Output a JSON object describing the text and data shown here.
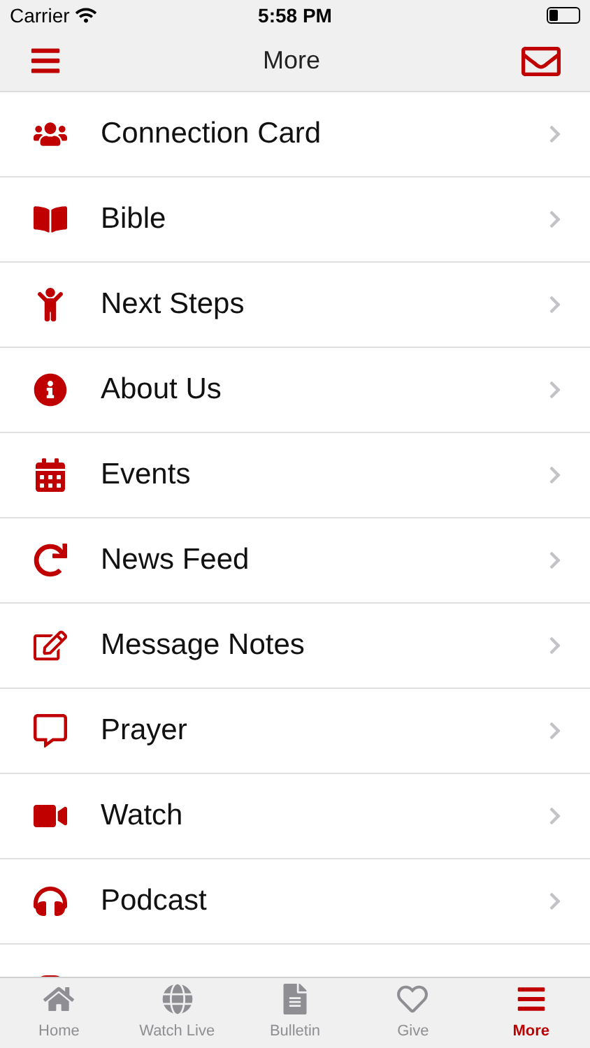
{
  "status_bar": {
    "carrier": "Carrier",
    "time": "5:58 PM"
  },
  "nav_bar": {
    "title": "More"
  },
  "menu": [
    {
      "label": "Connection Card"
    },
    {
      "label": "Bible"
    },
    {
      "label": "Next Steps"
    },
    {
      "label": "About Us"
    },
    {
      "label": "Events"
    },
    {
      "label": "News Feed"
    },
    {
      "label": "Message Notes"
    },
    {
      "label": "Prayer"
    },
    {
      "label": "Watch"
    },
    {
      "label": "Podcast"
    }
  ],
  "tabs": [
    {
      "label": "Home",
      "selected": false
    },
    {
      "label": "Watch Live",
      "selected": false
    },
    {
      "label": "Bulletin",
      "selected": false
    },
    {
      "label": "Give",
      "selected": false
    },
    {
      "label": "More",
      "selected": true
    }
  ]
}
